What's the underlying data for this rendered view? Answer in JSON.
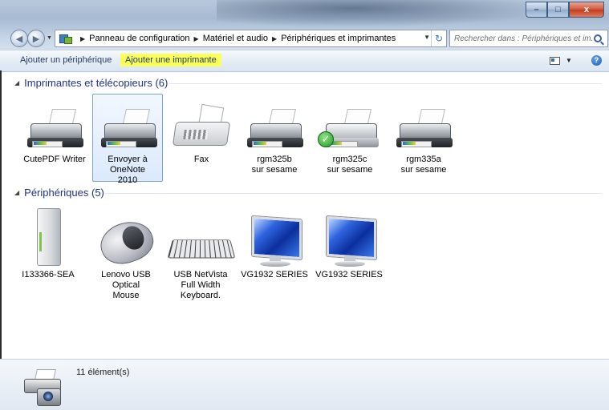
{
  "window": {
    "minimize_label": "",
    "maximize_label": "",
    "close_label": "x"
  },
  "nav": {
    "breadcrumbs": [
      "Panneau de configuration",
      "Matériel et audio",
      "Périphériques et imprimantes"
    ],
    "search_placeholder": "Rechercher dans : Périphériques et im..."
  },
  "toolbar": {
    "add_device": "Ajouter un périphérique",
    "add_printer": "Ajouter une imprimante",
    "help_symbol": "?"
  },
  "sections": {
    "printers": {
      "title": "Imprimantes et télécopieurs (6)",
      "items": [
        {
          "label": "CutePDF Writer",
          "icon": "printer-icon"
        },
        {
          "label": "Envoyer à OneNote 2010",
          "icon": "printer-icon"
        },
        {
          "label": "Fax",
          "icon": "fax-icon"
        },
        {
          "label": "rgm325b sur sesame",
          "icon": "printer-icon"
        },
        {
          "label": "rgm325c sur sesame",
          "icon": "printer-icon",
          "default": true
        },
        {
          "label": "rgm335a sur sesame",
          "icon": "printer-icon"
        }
      ]
    },
    "devices": {
      "title": "Périphériques (5)",
      "items": [
        {
          "label": "I133366-SEA",
          "icon": "drive-icon"
        },
        {
          "label": "Lenovo USB Optical Mouse",
          "icon": "mouse-icon"
        },
        {
          "label": "USB NetVista Full Width Keyboard.",
          "icon": "keyboard-icon"
        },
        {
          "label": "VG1932 SERIES",
          "icon": "monitor-icon"
        },
        {
          "label": "VG1932 SERIES",
          "icon": "monitor-icon"
        }
      ]
    }
  },
  "status": {
    "count": "11 élément(s)"
  },
  "colors": {
    "highlight": "#faff5a",
    "section_title": "#1e3287",
    "selection_border": "#7da2ce"
  }
}
